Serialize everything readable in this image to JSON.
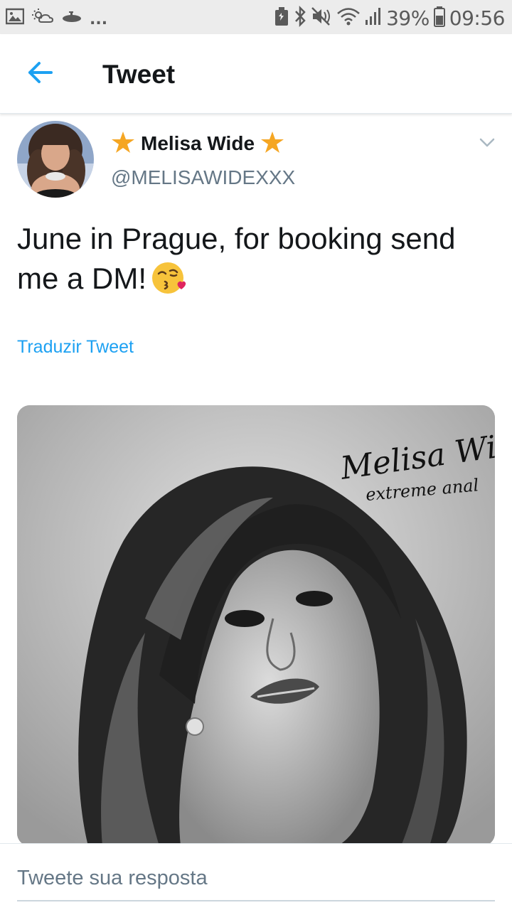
{
  "status_bar": {
    "battery_percent": "39%",
    "time": "09:56",
    "more": "...",
    "icons": [
      "gallery-icon",
      "weather-icon",
      "submarine-icon",
      "battery-saver-icon",
      "bluetooth-icon",
      "mute-icon",
      "wifi-icon",
      "signal-icon",
      "battery-icon"
    ]
  },
  "app_bar": {
    "title": "Tweet",
    "back_icon": "arrow-left-icon"
  },
  "tweet": {
    "author_name": "Melisa Wide",
    "handle": "@MELISAWIDEXXX",
    "text": "June in Prague, for booking send me a DM!",
    "emoji": "face-blowing-kiss",
    "translate_label": "Traduzir Tweet",
    "media_caption_line1": "Melisa Wide",
    "media_caption_line2": "extreme anal"
  },
  "reply": {
    "placeholder": "Tweete sua resposta"
  },
  "colors": {
    "accent": "#1da1f2",
    "star": "#f5a623",
    "secondary_text": "#657786",
    "status_bar_bg": "#ececec"
  }
}
